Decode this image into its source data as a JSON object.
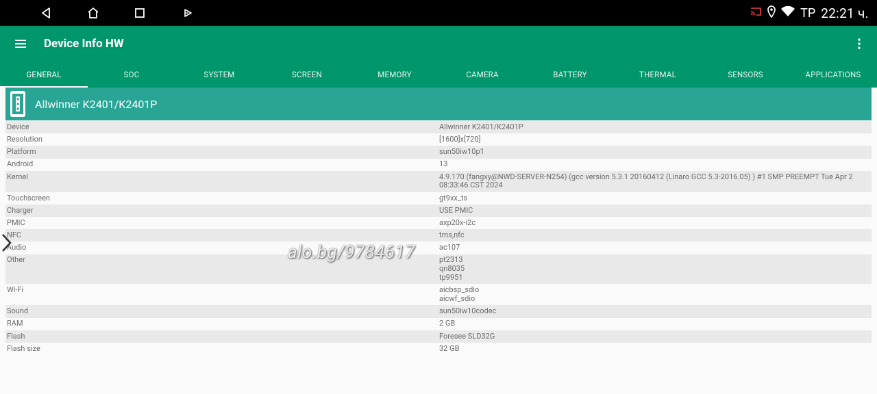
{
  "status": {
    "carrier": "ТР",
    "time": "22:21 ч.",
    "icons": [
      "cast-icon",
      "location-icon",
      "wifi-icon"
    ]
  },
  "nav": [
    "back-icon",
    "home-icon",
    "recents-icon",
    "play-icon"
  ],
  "app": {
    "title": "Device Info HW",
    "tabs": [
      "GENERAL",
      "SOC",
      "SYSTEM",
      "SCREEN",
      "MEMORY",
      "CAMERA",
      "BATTERY",
      "THERMAL",
      "SENSORS",
      "APPLICATIONS"
    ],
    "active_tab": "GENERAL"
  },
  "card": {
    "device_name": "Allwinner K2401/K2401P"
  },
  "rows": [
    {
      "key": "Device",
      "value": "Allwinner K2401/K2401P"
    },
    {
      "key": "Resolution",
      "value": "[1600]x[720]"
    },
    {
      "key": "Platform",
      "value": "sun50iw10p1"
    },
    {
      "key": "Android",
      "value": "13"
    },
    {
      "key": "Kernel",
      "value": "4.9.170 (fangxy@NWD-SERVER-N254) (gcc version 5.3.1 20160412 (Linaro GCC 5.3-2016.05) ) #1 SMP PREEMPT Tue Apr 2\n08:33:46 CST 2024"
    },
    {
      "key": "Touchscreen",
      "value": "gt9xx_ts"
    },
    {
      "key": "Charger",
      "value": "USE PMIC"
    },
    {
      "key": "PMIC",
      "value": "axp20x-i2c"
    },
    {
      "key": "NFC",
      "value": "tms,nfc"
    },
    {
      "key": "Audio",
      "value": "ac107"
    },
    {
      "key": "Other",
      "value": "pt2313\nqn8035\ntp9951"
    },
    {
      "key": "Wi-Fi",
      "value": "aicbsp_sdio\naicwf_sdio"
    },
    {
      "key": "Sound",
      "value": "sun50iw10codec"
    },
    {
      "key": "RAM",
      "value": "2 GB"
    },
    {
      "key": "Flash",
      "value": "Foresee SLD32G"
    },
    {
      "key": "Flash size",
      "value": "32 GB"
    }
  ],
  "watermark": "alo.bg/9784617",
  "colors": {
    "appbar": "#00966b",
    "card_header": "#28a595",
    "row_shade": "#e9e9e9"
  }
}
